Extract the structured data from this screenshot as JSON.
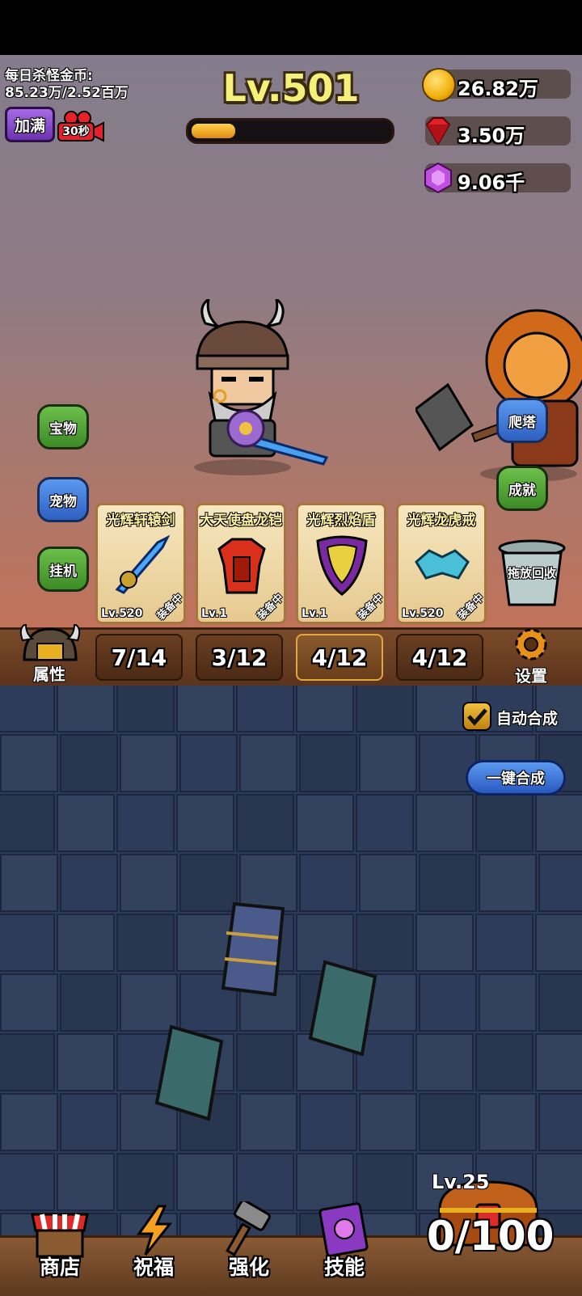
{
  "hud": {
    "daily_gold_label": "每日杀怪金币:",
    "daily_gold_value": "85.23万/2.52百万",
    "fill_button": "加满",
    "ad_timer": "30秒",
    "level": "Lv.501",
    "xp_progress": 0.22
  },
  "resources": {
    "gold": "26.82万",
    "ruby": "3.50万",
    "amethyst": "9.06千"
  },
  "side_left": [
    "宝物",
    "宠物",
    "挂机"
  ],
  "side_right": [
    "爬塔",
    "成就"
  ],
  "equipment": [
    {
      "title": "光辉轩辕剑",
      "level": "Lv.520",
      "status": "装备中"
    },
    {
      "title": "大天使盘龙铠",
      "level": "Lv.1",
      "status": "装备中"
    },
    {
      "title": "光辉烈焰盾",
      "level": "Lv.1",
      "status": "装备中"
    },
    {
      "title": "光辉龙虎戒",
      "level": "Lv.520",
      "status": "装备中"
    }
  ],
  "recycle_label": "拖放回收",
  "slots": {
    "attributes_label": "属性",
    "counts": [
      "7/14",
      "3/12",
      "4/12",
      "4/12"
    ],
    "active_index": 2,
    "settings_label": "设置"
  },
  "merge": {
    "auto_label": "自动合成",
    "auto_checked": true,
    "one_click_label": "一键合成"
  },
  "chest": {
    "level": "Lv.25",
    "count": "0/100"
  },
  "nav": [
    "商店",
    "祝福",
    "强化",
    "技能"
  ],
  "colors": {
    "level_text": "#f5f07a",
    "xp_fill": "#f2a21e",
    "gold": "#f7c21a",
    "ruby": "#e0202a",
    "amethyst": "#c050e0"
  }
}
